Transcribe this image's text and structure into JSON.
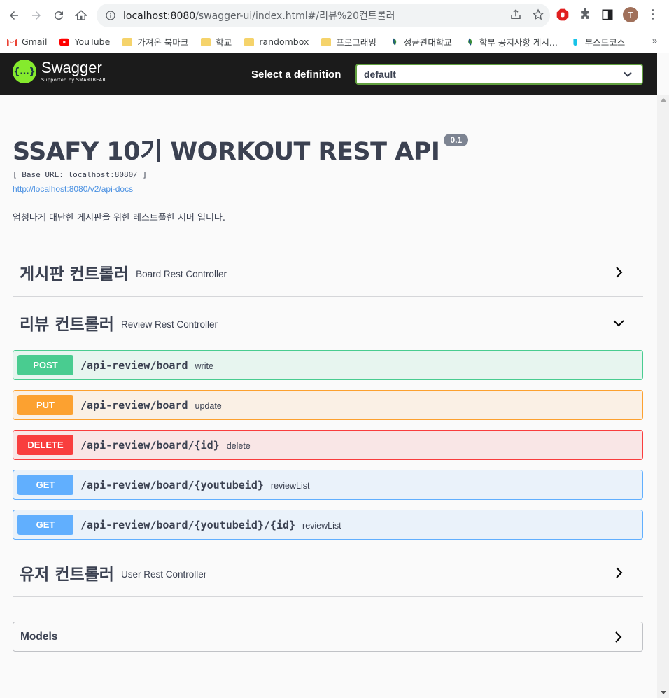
{
  "browser": {
    "url_host": "localhost:8080",
    "url_path": "/swagger-ui/index.html#/리뷰%20컨트롤러",
    "avatar_letter": "T",
    "bookmarks": [
      {
        "label": "Gmail",
        "icon": "gmail-icon"
      },
      {
        "label": "YouTube",
        "icon": "youtube-icon"
      },
      {
        "label": "가져온 북마크",
        "icon": "folder-icon"
      },
      {
        "label": "학교",
        "icon": "folder-icon"
      },
      {
        "label": "randombox",
        "icon": "folder-icon"
      },
      {
        "label": "프로그래밍",
        "icon": "folder-icon"
      },
      {
        "label": "성균관대학교",
        "icon": "skku-icon"
      },
      {
        "label": "학부 공지사항 게시...",
        "icon": "skku-icon"
      },
      {
        "label": "부스트코스",
        "icon": "boostcourse-icon"
      }
    ],
    "more": "»"
  },
  "topbar": {
    "brand": "Swagger",
    "brand_sub": "Supported by SMARTBEAR",
    "definition_label": "Select a definition",
    "definition_value": "default"
  },
  "info": {
    "title": "SSAFY 10기 WORKOUT REST API",
    "version": "0.1",
    "base_url": "[ Base URL: localhost:8080/ ]",
    "api_docs": "http://localhost:8080/v2/api-docs",
    "description": "엄청나게 대단한 게시판을 위한 레스트풀한 서버 입니다."
  },
  "tags": [
    {
      "name": "게시판 컨트롤러",
      "description": "Board Rest Controller",
      "expanded": false
    },
    {
      "name": "리뷰 컨트롤러",
      "description": "Review Rest Controller",
      "expanded": true
    },
    {
      "name": "유저 컨트롤러",
      "description": "User Rest Controller",
      "expanded": false
    }
  ],
  "operations": [
    {
      "method": "POST",
      "path": "/api-review/board",
      "summary": "write"
    },
    {
      "method": "PUT",
      "path": "/api-review/board",
      "summary": "update"
    },
    {
      "method": "DELETE",
      "path": "/api-review/board/{id}",
      "summary": "delete"
    },
    {
      "method": "GET",
      "path": "/api-review/board/{youtubeid}",
      "summary": "reviewList"
    },
    {
      "method": "GET",
      "path": "/api-review/board/{youtubeid}/{id}",
      "summary": "reviewList"
    }
  ],
  "models": {
    "label": "Models"
  },
  "colors": {
    "post": "#49cc90",
    "put": "#fca130",
    "delete": "#f93e3e",
    "get": "#61affe",
    "swagger_green": "#85ea2d"
  }
}
